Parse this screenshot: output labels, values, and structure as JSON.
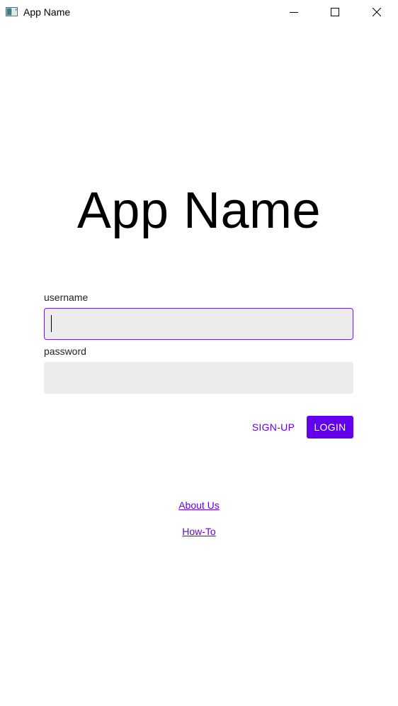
{
  "window": {
    "title": "App Name",
    "controls": [
      "minimize-icon",
      "maximize-icon",
      "close-icon"
    ]
  },
  "main": {
    "hero_title": "App Name",
    "username": {
      "label": "username",
      "value": "",
      "placeholder": ""
    },
    "password": {
      "label": "password",
      "value": "",
      "placeholder": ""
    },
    "signup_label": "SIGN-UP",
    "login_label": "LOGIN"
  },
  "links": {
    "about": "About Us",
    "howto": "How-To"
  },
  "colors": {
    "accent": "#6200ee",
    "input_bg": "#ececec",
    "focus_border": "#6a22d4"
  }
}
